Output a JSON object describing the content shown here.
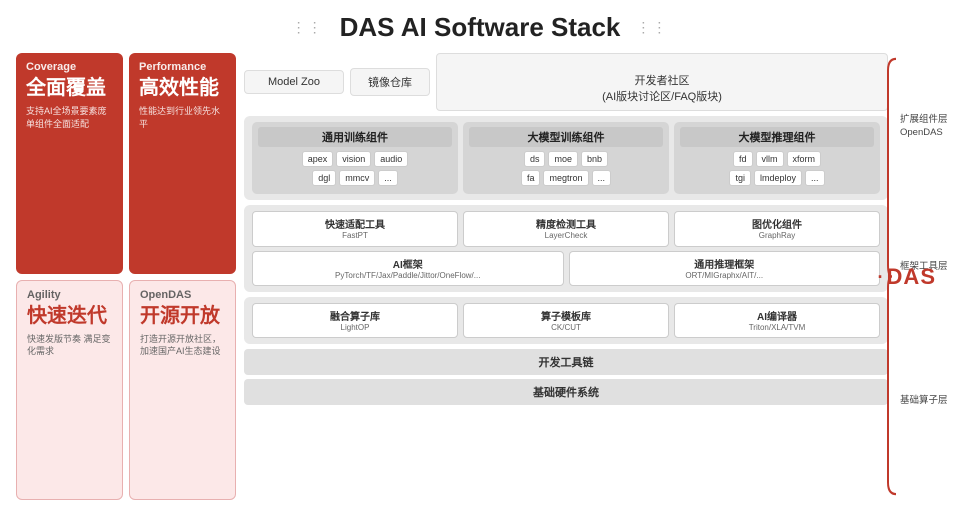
{
  "title": "DAS AI Software Stack",
  "dots": "⋮⋮",
  "left_cards": [
    {
      "id": "coverage",
      "en": "Coverage",
      "zh": "全面覆盖",
      "desc": "支持AI全场景要素庞\n单组件全面适配",
      "style": "red"
    },
    {
      "id": "performance",
      "en": "Performance",
      "zh": "高效性能",
      "desc": "性能达到行业领先水平",
      "style": "red"
    },
    {
      "id": "agility",
      "en": "Agility",
      "zh": "快速迭代",
      "desc": "快速发版节奏\n满足变化需求",
      "style": "light"
    },
    {
      "id": "opendas",
      "en": "OpenDAS",
      "zh": "开源开放",
      "desc": "打造开源开放社区，\n加速国产AI生态建设",
      "style": "light"
    }
  ],
  "top_bar": {
    "items": [
      {
        "id": "model-zoo",
        "label": "Model Zoo"
      },
      {
        "id": "mirror-repo",
        "label": "镜像仓库"
      },
      {
        "id": "dev-community",
        "label": "开发者社区\n(AI版块讨论区/FAQ版块)"
      }
    ]
  },
  "training_section": {
    "cols": [
      {
        "id": "general-training",
        "title": "通用训练组件",
        "rows": [
          [
            "apex",
            "vision",
            "audio"
          ],
          [
            "dgl",
            "mmcv",
            "..."
          ]
        ]
      },
      {
        "id": "large-model-training",
        "title": "大模型训练组件",
        "rows": [
          [
            "ds",
            "moe",
            "bnb"
          ],
          [
            "fa",
            "megtron",
            "..."
          ]
        ]
      },
      {
        "id": "large-model-inference",
        "title": "大模型推理组件",
        "rows": [
          [
            "fd",
            "vllm",
            "xform"
          ],
          [
            "tgi",
            "lmdeploy",
            "..."
          ]
        ]
      }
    ]
  },
  "expand_layer": "扩展组件层\nOpenDAS",
  "framework_section": {
    "tools": [
      {
        "id": "fastpt",
        "title": "快速适配工具",
        "sub": "FastPT"
      },
      {
        "id": "layercheck",
        "title": "精度检测工具",
        "sub": "LayerCheck"
      },
      {
        "id": "graphray",
        "title": "图优化组件",
        "sub": "GraphRay"
      }
    ],
    "bottom": [
      {
        "id": "ai-framework",
        "title": "AI框架",
        "sub": "PyTorch/TF/Jax/Paddle/Jittor/OneFlow/..."
      },
      {
        "id": "inference-framework",
        "title": "通用推理框架",
        "sub": "ORT/MIGraphx/AIT/..."
      }
    ]
  },
  "framework_layer": "框架工具层",
  "compute_section": {
    "boxes": [
      {
        "id": "fusion-op",
        "title": "融合算子库",
        "sub": "LightOP"
      },
      {
        "id": "op-template",
        "title": "算子模板库",
        "sub": "CK/CUT"
      },
      {
        "id": "ai-compiler",
        "title": "AI编译器",
        "sub": "Triton/XLA/TVM"
      }
    ]
  },
  "compute_layer": "基础算子层",
  "bottom_bars": [
    {
      "id": "dev-toolchain",
      "label": "开发工具链"
    },
    {
      "id": "hw-system",
      "label": "基础硬件系统"
    }
  ],
  "das_logo": "DAS",
  "das_logo_prefix": "·"
}
